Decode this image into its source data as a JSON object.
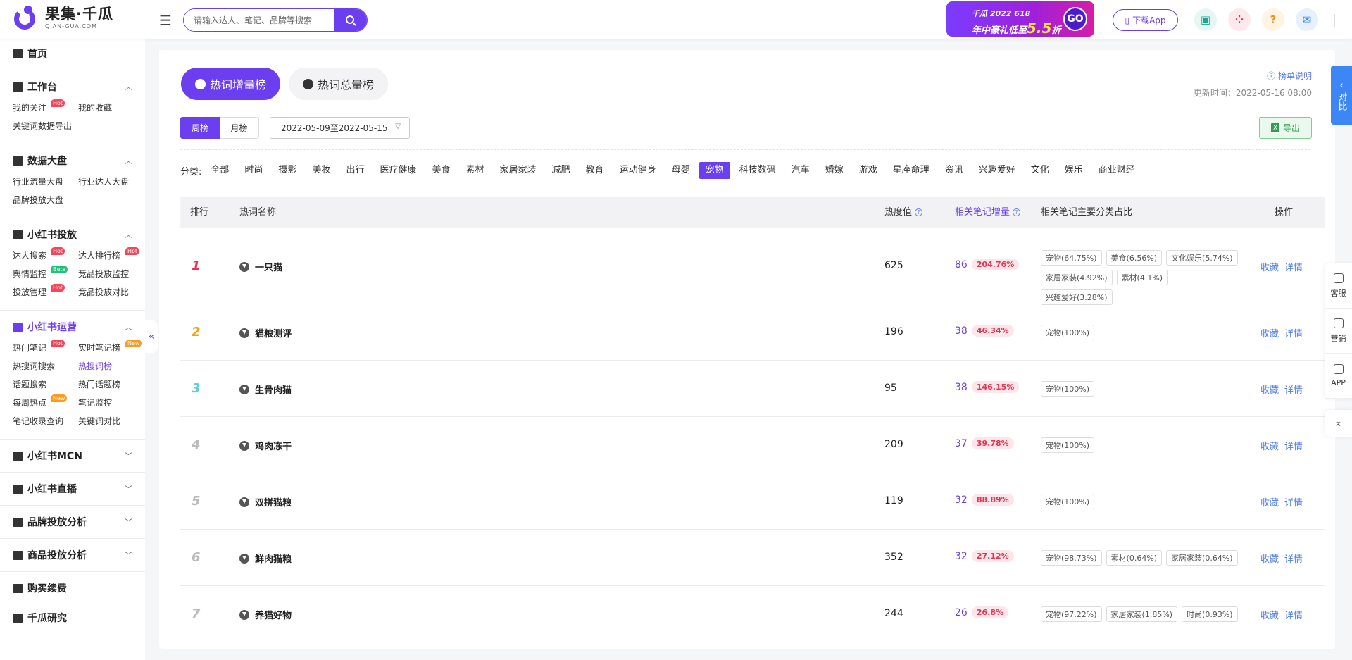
{
  "brand": {
    "name_cn": "果集·千瓜",
    "name_en": "QIAN-GUA.COM",
    "accent": "#6b3ff0"
  },
  "search": {
    "placeholder": "请输入达人、笔记、品牌等搜索"
  },
  "promo": {
    "line1": "千瓜 2022 618",
    "line2": "年中豪礼低至",
    "discount": "5.5",
    "unit": "折",
    "go": "GO"
  },
  "header": {
    "download_label": "下载App"
  },
  "sidebar": {
    "home": "首页",
    "sections": [
      {
        "title": "工作台",
        "items": [
          {
            "label": "我的关注",
            "badge": "Hot"
          },
          {
            "label": "我的收藏"
          },
          {
            "label": "关键词数据导出"
          }
        ]
      },
      {
        "title": "数据大盘",
        "items": [
          {
            "label": "行业流量大盘"
          },
          {
            "label": "行业达人大盘"
          },
          {
            "label": "品牌投放大盘"
          }
        ]
      },
      {
        "title": "小红书投放",
        "items": [
          {
            "label": "达人搜索",
            "badge": "Hot"
          },
          {
            "label": "达人排行榜",
            "badge": "Hot"
          },
          {
            "label": "舆情监控",
            "badge": "Beta"
          },
          {
            "label": "竞品投放监控"
          },
          {
            "label": "投放管理",
            "badge": "Hot"
          },
          {
            "label": "竞品投放对比"
          }
        ]
      },
      {
        "title": "小红书运营",
        "items": [
          {
            "label": "热门笔记",
            "badge": "Hot"
          },
          {
            "label": "实时笔记榜",
            "badge": "New"
          },
          {
            "label": "热搜词搜索"
          },
          {
            "label": "热搜词榜"
          },
          {
            "label": "话题搜索"
          },
          {
            "label": "热门话题榜"
          },
          {
            "label": "每周热点",
            "badge": "New"
          },
          {
            "label": "笔记监控"
          },
          {
            "label": "笔记收录查询"
          },
          {
            "label": "关键词对比"
          }
        ]
      }
    ],
    "collapsed": [
      "小红书MCN",
      "小红书直播",
      "品牌投放分析",
      "商品投放分析"
    ],
    "buy": "购买续费",
    "more": "千瓜研究"
  },
  "main": {
    "tabs": [
      "热词增量榜",
      "热词总量榜"
    ],
    "help": "榜单说明",
    "updated": "更新时间：2022-05-16 08:00",
    "period": [
      "周榜",
      "月榜"
    ],
    "daterange": "2022-05-09至2022-05-15",
    "export": "导出",
    "cat_label": "分类:",
    "categories": [
      "全部",
      "时尚",
      "摄影",
      "美妆",
      "出行",
      "医疗健康",
      "美食",
      "素材",
      "家居家装",
      "减肥",
      "教育",
      "运动健身",
      "母婴",
      "宠物",
      "科技数码",
      "汽车",
      "婚嫁",
      "游戏",
      "星座命理",
      "资讯",
      "兴趣爱好",
      "文化",
      "娱乐",
      "商业财经"
    ],
    "active_category": "宠物",
    "columns": {
      "rank": "排行",
      "name": "热词名称",
      "heat": "热度值",
      "inc": "相关笔记增量",
      "share": "相关笔记主要分类占比",
      "ops": "操作"
    },
    "ops": {
      "fav": "收藏",
      "detail": "详情"
    }
  },
  "rows": [
    {
      "rank": "1",
      "keyword": "一只猫",
      "heat": "625",
      "inc": "86",
      "pct": "204.76%",
      "shares": [
        "宠物(64.75%)",
        "美食(6.56%)",
        "文化娱乐(5.74%)",
        "家居家装(4.92%)",
        "素材(4.1%)",
        "兴趣爱好(3.28%)"
      ]
    },
    {
      "rank": "2",
      "keyword": "猫粮测评",
      "heat": "196",
      "inc": "38",
      "pct": "46.34%",
      "shares": [
        "宠物(100%)"
      ]
    },
    {
      "rank": "3",
      "keyword": "生骨肉猫",
      "heat": "95",
      "inc": "38",
      "pct": "146.15%",
      "shares": [
        "宠物(100%)"
      ]
    },
    {
      "rank": "4",
      "keyword": "鸡肉冻干",
      "heat": "209",
      "inc": "37",
      "pct": "39.78%",
      "shares": [
        "宠物(100%)"
      ]
    },
    {
      "rank": "5",
      "keyword": "双拼猫粮",
      "heat": "119",
      "inc": "32",
      "pct": "88.89%",
      "shares": [
        "宠物(100%)"
      ]
    },
    {
      "rank": "6",
      "keyword": "鲜肉猫粮",
      "heat": "352",
      "inc": "32",
      "pct": "27.12%",
      "shares": [
        "宠物(98.73%)",
        "素材(0.64%)",
        "家居家装(0.64%)"
      ]
    },
    {
      "rank": "7",
      "keyword": "养猫好物",
      "heat": "244",
      "inc": "26",
      "pct": "26.8%",
      "shares": [
        "宠物(97.22%)",
        "家居家装(1.85%)",
        "时尚(0.93%)"
      ]
    }
  ],
  "right": {
    "vs": "对比",
    "tools": [
      "客服",
      "营销",
      "APP"
    ]
  },
  "rank_colors": [
    "#e8334f",
    "#f0a21a",
    "#5ccfcf",
    "#bbbbbb",
    "#bbbbbb",
    "#bbbbbb",
    "#bbbbbb"
  ]
}
